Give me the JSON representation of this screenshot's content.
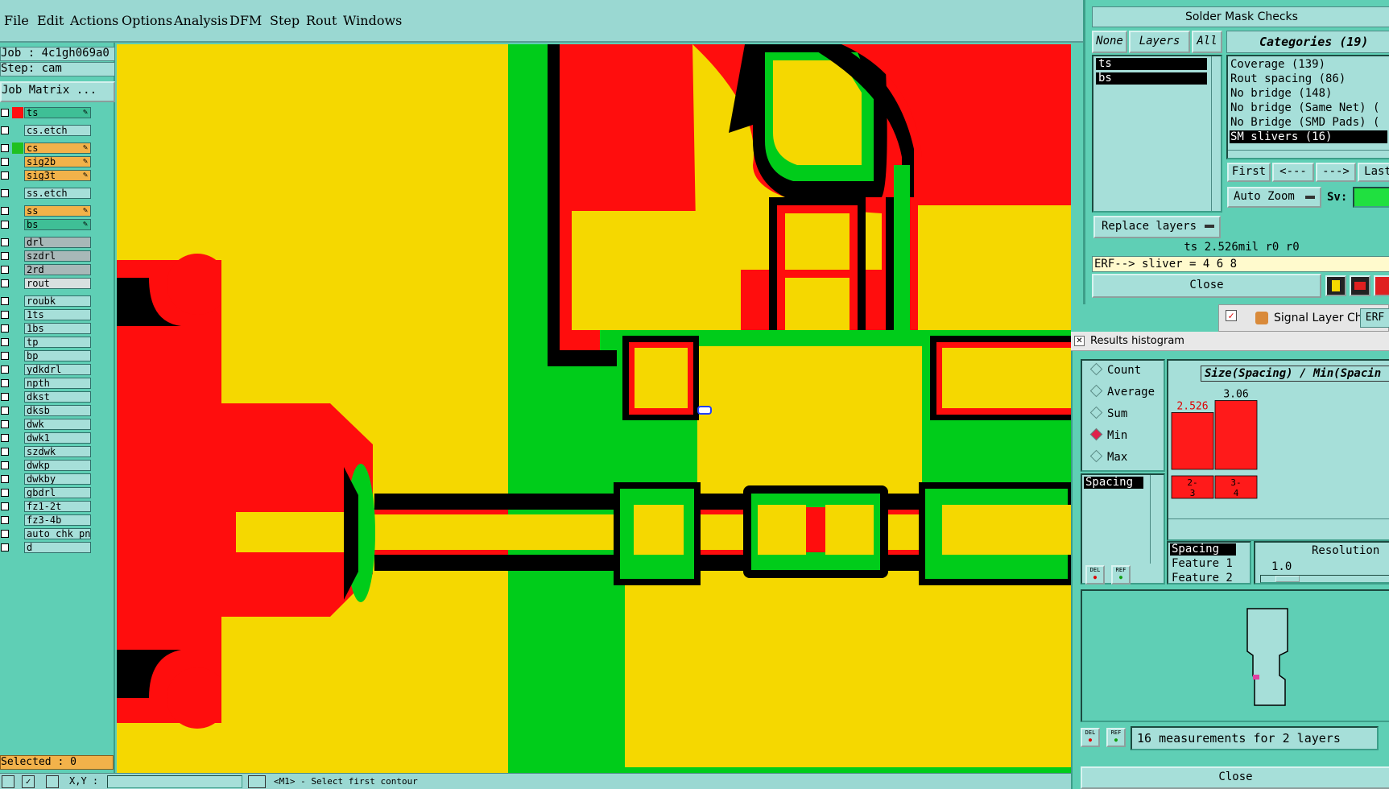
{
  "menu": [
    "File",
    "Edit",
    "Actions",
    "Options",
    "Analysis",
    "DFM",
    "Step",
    "Rout",
    "Windows"
  ],
  "job": {
    "job_line": "Job : 4c1gh069a0",
    "step_line": "Step: cam",
    "matrix_button": "Job Matrix ..."
  },
  "layers": [
    {
      "name": "ts",
      "bg": "#3fbf96",
      "swatch": "#ff1010",
      "edit": true
    },
    {
      "name": "cs.etch",
      "bg": "#a6dfd9",
      "swatch": "",
      "edit": false
    },
    {
      "name": "cs",
      "bg": "#f2b24a",
      "swatch": "#20c020",
      "edit": true
    },
    {
      "name": "sig2b",
      "bg": "#f2b24a",
      "swatch": "",
      "edit": true
    },
    {
      "name": "sig3t",
      "bg": "#f2b24a",
      "swatch": "",
      "edit": true
    },
    {
      "name": "ss.etch",
      "bg": "#a6dfd9",
      "swatch": "",
      "edit": false
    },
    {
      "name": "ss",
      "bg": "#f2b24a",
      "swatch": "",
      "edit": true
    },
    {
      "name": "bs",
      "bg": "#3fbf96",
      "swatch": "",
      "edit": true
    },
    {
      "name": "drl",
      "bg": "#a8b8b8",
      "swatch": "",
      "edit": false
    },
    {
      "name": "szdrl",
      "bg": "#a8b8b8",
      "swatch": "",
      "edit": false
    },
    {
      "name": "2rd",
      "bg": "#a8b8b8",
      "swatch": "",
      "edit": false
    },
    {
      "name": "rout",
      "bg": "#d8e0e0",
      "swatch": "",
      "edit": false
    },
    {
      "name": "roubk",
      "bg": "#a6dfd9",
      "swatch": "",
      "edit": false
    },
    {
      "name": "1ts",
      "bg": "#a6dfd9",
      "swatch": "",
      "edit": false
    },
    {
      "name": "1bs",
      "bg": "#a6dfd9",
      "swatch": "",
      "edit": false
    },
    {
      "name": "tp",
      "bg": "#a6dfd9",
      "swatch": "",
      "edit": false
    },
    {
      "name": "bp",
      "bg": "#a6dfd9",
      "swatch": "",
      "edit": false
    },
    {
      "name": "ydkdrl",
      "bg": "#a6dfd9",
      "swatch": "",
      "edit": false
    },
    {
      "name": "npth",
      "bg": "#a6dfd9",
      "swatch": "",
      "edit": false
    },
    {
      "name": "dkst",
      "bg": "#a6dfd9",
      "swatch": "",
      "edit": false
    },
    {
      "name": "dksb",
      "bg": "#a6dfd9",
      "swatch": "",
      "edit": false
    },
    {
      "name": "dwk",
      "bg": "#a6dfd9",
      "swatch": "",
      "edit": false
    },
    {
      "name": "dwk1",
      "bg": "#a6dfd9",
      "swatch": "",
      "edit": false
    },
    {
      "name": "szdwk",
      "bg": "#a6dfd9",
      "swatch": "",
      "edit": false
    },
    {
      "name": "dwkp",
      "bg": "#a6dfd9",
      "swatch": "",
      "edit": false
    },
    {
      "name": "dwkby",
      "bg": "#a6dfd9",
      "swatch": "",
      "edit": false
    },
    {
      "name": "gbdrl",
      "bg": "#a6dfd9",
      "swatch": "",
      "edit": false
    },
    {
      "name": "fz1-2t",
      "bg": "#a6dfd9",
      "swatch": "",
      "edit": false
    },
    {
      "name": "fz3-4b",
      "bg": "#a6dfd9",
      "swatch": "",
      "edit": false
    },
    {
      "name": "auto_chk_pn",
      "bg": "#a6dfd9",
      "swatch": "",
      "edit": false
    },
    {
      "name": "d",
      "bg": "#a6dfd9",
      "swatch": "",
      "edit": false
    }
  ],
  "status": {
    "selected": "Selected : 0",
    "xy_label": "X,Y :",
    "prompt": "<M1> - Select first contour"
  },
  "solder_mask": {
    "title": "Solder Mask Checks",
    "btn_none": "None",
    "btn_layers": "Layers",
    "btn_all": "All",
    "layers": [
      "ts",
      "bs"
    ],
    "categories_header": "Categories (19)",
    "categories": [
      "Coverage (139)",
      "Rout spacing (86)",
      "No bridge (148)",
      "No bridge (Same Net) (",
      "No Bridge (SMD Pads) (",
      "SM slivers (16)"
    ],
    "selected_category_index": 5,
    "nav": [
      "First",
      "<---",
      "--->",
      "Last"
    ],
    "auto_zoom": "Auto Zoom",
    "sv_label": "Sv:",
    "replace_layers": "Replace layers",
    "info_line": "ts 2.526mil  r0  r0",
    "erf_line": "ERF--> sliver = 4 6 8",
    "close": "Close"
  },
  "signal_tab": {
    "label": "Signal Layer Ch",
    "erf": "ERF"
  },
  "histogram": {
    "title": "Results histogram",
    "options": [
      "Count",
      "Average",
      "Sum",
      "Min",
      "Max"
    ],
    "selected_option": "Min",
    "list_item": "Spacing",
    "chart_title": "Size(Spacing) / Min(Spacin",
    "resolution_label": "Resolution",
    "resolution_value": "1.0",
    "attr_list": [
      "Spacing",
      "Feature 1",
      "Feature 2"
    ],
    "measurements": "16 measurements for 2 layers",
    "close": "Close",
    "del_label": "DEL",
    "ref_label": "REF"
  },
  "chart_data": {
    "type": "bar",
    "title": "Size(Spacing) / Min(Spacin",
    "categories": [
      "2-3",
      "3-4"
    ],
    "category_labels": [
      [
        "2-",
        "3"
      ],
      [
        "3-",
        "4"
      ]
    ],
    "values": [
      2.526,
      3.06
    ],
    "value_labels": [
      "2.526",
      "3.06"
    ],
    "value_label_colors": [
      "#e00000",
      "#000000"
    ],
    "bar_color": "#ff1a1a",
    "ylim": [
      0,
      3.4
    ]
  }
}
